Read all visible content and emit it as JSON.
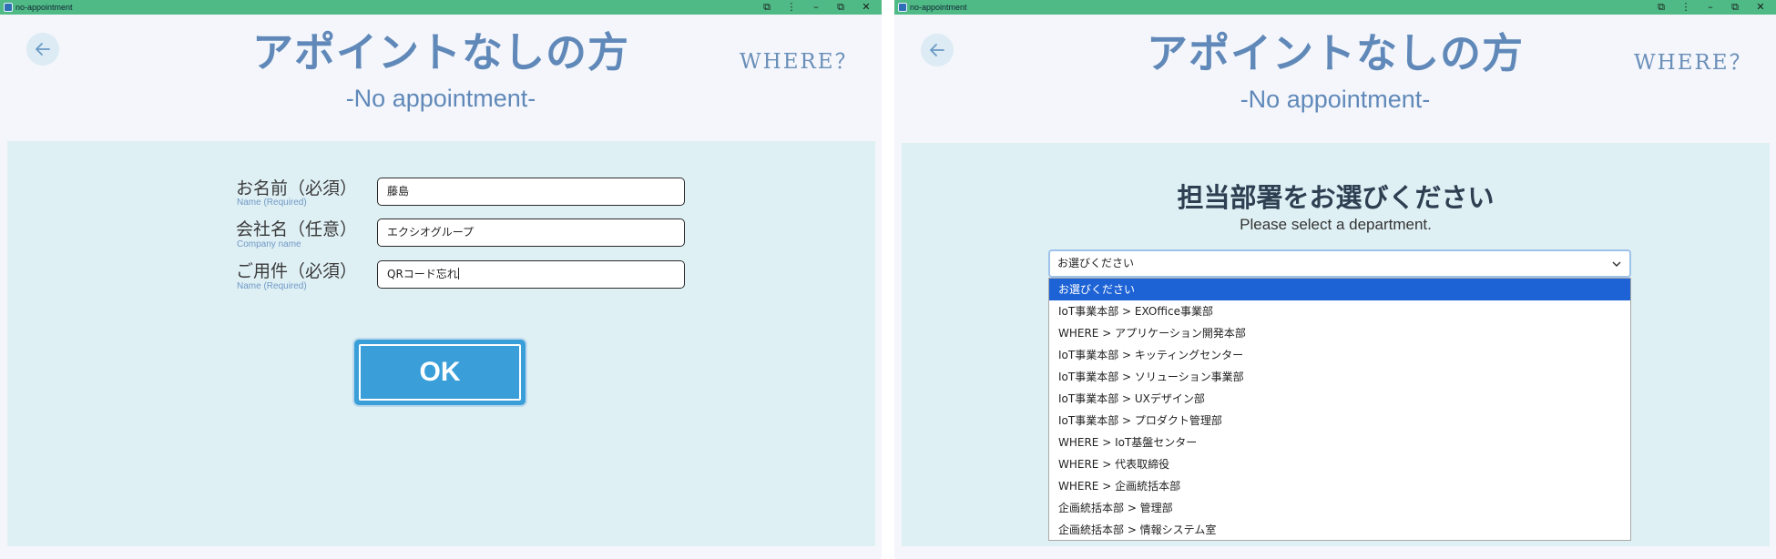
{
  "window": {
    "title": "no-appointment",
    "controls": {
      "extensions_glyph": "⧉",
      "menu_glyph": "⋮",
      "minimize_glyph": "–",
      "restore_glyph": "⧉",
      "close_glyph": "✕"
    }
  },
  "header": {
    "title_jp": "アポイントなしの方",
    "title_en": "-No appointment-",
    "brand": "WHERE？"
  },
  "form": {
    "fields": [
      {
        "label_jp": "お名前（必須）",
        "label_en": "Name (Required)",
        "value": "藤島"
      },
      {
        "label_jp": "会社名（任意）",
        "label_en": "Company name",
        "value": "エクシオグループ"
      },
      {
        "label_jp": "ご用件（必須）",
        "label_en": "Name (Required)",
        "value": "QRコード忘れ"
      }
    ],
    "ok_label": "OK"
  },
  "department": {
    "title_jp": "担当部署をお選びください",
    "subtitle_en": "Please select a department.",
    "selected_value": "お選びください",
    "options": [
      "お選びください",
      "IoT事業本部 > EXOffice事業部",
      "WHERE > アプリケーション開発本部",
      "IoT事業本部 > キッティングセンター",
      "IoT事業本部 > ソリューション事業部",
      "IoT事業本部 > UXデザイン部",
      "IoT事業本部 > プロダクト管理部",
      "WHERE > IoT基盤センター",
      "WHERE > 代表取締役",
      "WHERE > 企画統括本部",
      "企画統括本部 > 管理部",
      "企画統括本部 > 情報システム室"
    ]
  },
  "colors": {
    "titlebar": "#4fba86",
    "heading": "#6089b9",
    "panel": "#dff0f5",
    "ok_button": "#3a9fd9",
    "option_highlight": "#1e63d6"
  }
}
